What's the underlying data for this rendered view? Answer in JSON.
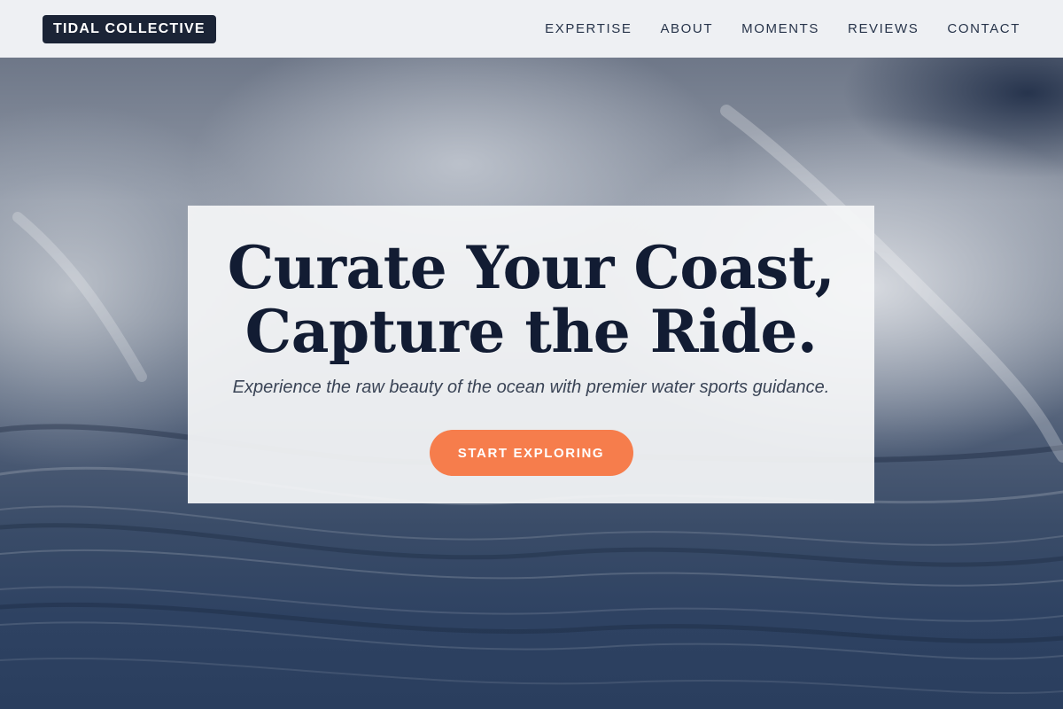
{
  "header": {
    "logo": "TIDAL COLLECTIVE",
    "nav": [
      {
        "label": "EXPERTISE"
      },
      {
        "label": "ABOUT"
      },
      {
        "label": "MOMENTS"
      },
      {
        "label": "REVIEWS"
      },
      {
        "label": "CONTACT"
      }
    ]
  },
  "hero": {
    "title_line1": "Curate Your Coast,",
    "title_line2": "Capture the Ride.",
    "subtitle": "Experience the raw beauty of the ocean with premier water sports guidance.",
    "cta_label": "START EXPLORING"
  },
  "colors": {
    "header_bg": "#eef0f3",
    "logo_bg": "#1b2436",
    "title_text": "#121c33",
    "cta_bg": "#f67d4c"
  }
}
